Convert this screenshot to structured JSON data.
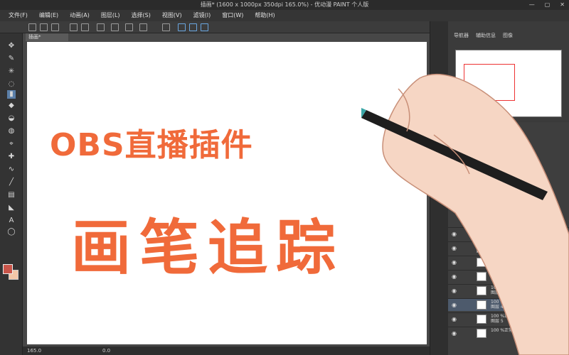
{
  "window": {
    "title": "插画* (1600 x 1000px 350dpi 165.0%)  - 优动漫 PAINT 个人版",
    "controls": [
      "—",
      "▢",
      "✕"
    ]
  },
  "menu": [
    "文件(F)",
    "编辑(E)",
    "动画(A)",
    "图层(L)",
    "选择(S)",
    "视图(V)",
    "滤镜(I)",
    "窗口(W)",
    "帮助(H)"
  ],
  "document": {
    "tab_label": "插画*"
  },
  "canvas": {
    "headline1": "OBS直播插件",
    "headline2": "画笔追踪",
    "accent": "#f06a3a"
  },
  "status": {
    "zoom": "165.0",
    "angle": "0.0"
  },
  "navigator": {
    "tabs": [
      "导航器",
      "辅助信息",
      "图像"
    ]
  },
  "layers": [
    {
      "opacity": "100 %正常",
      "name": ""
    },
    {
      "opacity": "100 %正常",
      "name": "无名"
    },
    {
      "opacity": "100 %正常",
      "name": "小辫插"
    },
    {
      "opacity": "100 %正常",
      "name": "阴影"
    },
    {
      "opacity": "100 %正常",
      "name": "图层 7"
    },
    {
      "opacity": "100 %正常",
      "name": "图层 4"
    },
    {
      "opacity": "100 %正常",
      "name": "图层 5"
    },
    {
      "opacity": "100 %正常",
      "name": ""
    }
  ],
  "tools": [
    "move-icon",
    "pen-icon",
    "sparkle-icon",
    "lasso-icon",
    "eraser-icon",
    "fill-icon",
    "blend-icon",
    "dropper-icon",
    "plus-icon",
    "curve-icon",
    "pen2-icon",
    "gradient-icon",
    "figure-icon",
    "text-icon",
    "speech-icon"
  ],
  "colors": {
    "main": "#c9554a",
    "sub": "#f3c7a8"
  }
}
